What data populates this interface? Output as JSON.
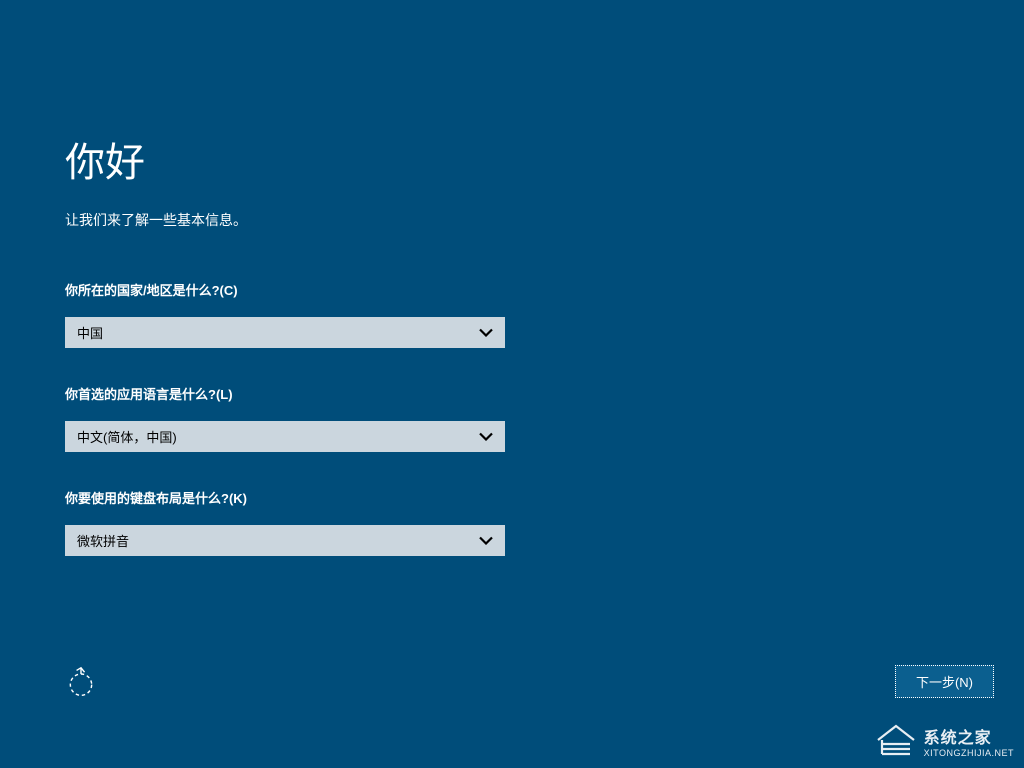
{
  "header": {
    "title": "你好",
    "subtitle": "让我们来了解一些基本信息。"
  },
  "form": {
    "country": {
      "label": "你所在的国家/地区是什么?(C)",
      "value": "中国"
    },
    "language": {
      "label": "你首选的应用语言是什么?(L)",
      "value": "中文(简体，中国)"
    },
    "keyboard": {
      "label": "你要使用的键盘布局是什么?(K)",
      "value": "微软拼音"
    }
  },
  "footer": {
    "next_label": "下一步(N)"
  },
  "watermark": {
    "title": "系统之家",
    "url": "XITONGZHIJIA.NET"
  }
}
